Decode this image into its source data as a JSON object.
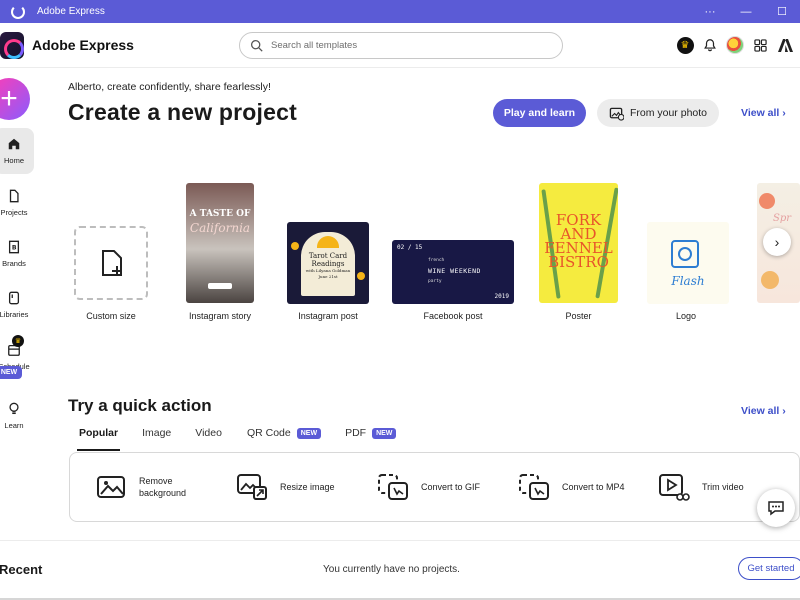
{
  "window": {
    "title": "Adobe Express",
    "controls": [
      "···",
      "—",
      "☐"
    ]
  },
  "header": {
    "brand": "Adobe Express",
    "search_placeholder": "Search all templates",
    "icons": [
      "crown-icon",
      "bell-icon",
      "avatar",
      "apps-grid-icon",
      "adobe-icon"
    ]
  },
  "nav": {
    "create_label": "+",
    "items": [
      {
        "label": "Home",
        "icon": "home-icon",
        "active": true
      },
      {
        "label": "Projects",
        "icon": "projects-icon"
      },
      {
        "label": "Brands",
        "icon": "brands-icon"
      },
      {
        "label": "Libraries",
        "icon": "libraries-icon"
      },
      {
        "label": "Schedule",
        "icon": "calendar-icon",
        "badge": "NEW"
      },
      {
        "label": "Learn",
        "icon": "lightbulb-icon"
      }
    ]
  },
  "hero": {
    "greeting": "Alberto, create confidently, share fearlessly!",
    "title": "Create a new project",
    "play_button": "Play and learn",
    "photo_button": "From your photo",
    "view_all": "View all"
  },
  "templates": [
    {
      "label": "Custom size"
    },
    {
      "label": "Instagram story",
      "art": {
        "line1": "A TASTE OF",
        "line2": "California",
        "cta": ""
      }
    },
    {
      "label": "Instagram post",
      "art": {
        "title": "Tarot Card Readings",
        "sub": "with Lilyana Goldman",
        "date": "June 21st"
      }
    },
    {
      "label": "Facebook post",
      "art": {
        "date": "02 / 15",
        "l1": "french",
        "l2": "WINE WEEKEND",
        "l3": "party",
        "year": "2019"
      }
    },
    {
      "label": "Poster",
      "art": {
        "text": "FORK AND FENNEL BISTRO"
      }
    },
    {
      "label": "Logo",
      "art": {
        "text": "Flash"
      }
    }
  ],
  "quick_actions": {
    "title": "Try a quick action",
    "view_all": "View all",
    "tabs": [
      {
        "label": "Popular",
        "active": true
      },
      {
        "label": "Image"
      },
      {
        "label": "Video"
      },
      {
        "label": "QR Code",
        "badge": "NEW"
      },
      {
        "label": "PDF",
        "badge": "NEW"
      }
    ],
    "actions": [
      {
        "label": "Remove background",
        "icon": "remove-background-icon"
      },
      {
        "label": "Resize image",
        "icon": "resize-image-icon"
      },
      {
        "label": "Convert to GIF",
        "icon": "convert-gif-icon"
      },
      {
        "label": "Convert to MP4",
        "icon": "convert-mp4-icon"
      },
      {
        "label": "Trim video",
        "icon": "trim-video-icon"
      }
    ]
  },
  "recent": {
    "title": "Recent",
    "empty_text": "You currently have no projects.",
    "get_started": "Get started"
  },
  "colors": {
    "accent": "#5b5bd6",
    "link": "#3d4fc9",
    "fab_start": "#ff3db4",
    "fab_end": "#8a5cff"
  }
}
